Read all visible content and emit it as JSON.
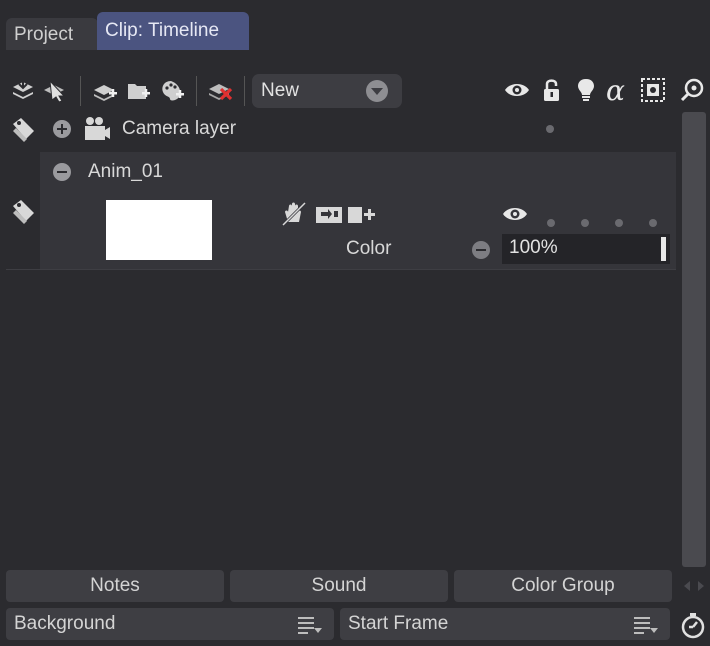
{
  "tabs": [
    {
      "label": "Project",
      "active": false
    },
    {
      "label": "Clip: Timeline",
      "active": true
    }
  ],
  "toolbar": {
    "icons": [
      "add-layer-icon",
      "hand-select-icon",
      "add-drawing-layer-icon",
      "add-folder-layer-icon",
      "add-palette-layer-icon",
      "delete-layer-icon"
    ],
    "preset_dropdown": {
      "selected": "New"
    },
    "column_icons": [
      "eye-icon",
      "lock-icon",
      "bulb-icon",
      "alpha-icon",
      "mask-icon",
      "zoom-icon"
    ]
  },
  "layers": {
    "camera": {
      "name": "Camera layer"
    },
    "anim": {
      "name": "Anim_01",
      "blend_label": "Color",
      "opacity": "100%"
    }
  },
  "bottom": {
    "notes_label": "Notes",
    "sound_label": "Sound",
    "color_group_label": "Color Group",
    "background_label": "Background",
    "start_frame_label": "Start Frame"
  },
  "colors": {
    "panel_bg": "#2b2b2f",
    "active_tab": "#4b5480",
    "group_bg": "#35353a",
    "button_bg": "#3e3e43",
    "delete_accent": "#e03030"
  }
}
